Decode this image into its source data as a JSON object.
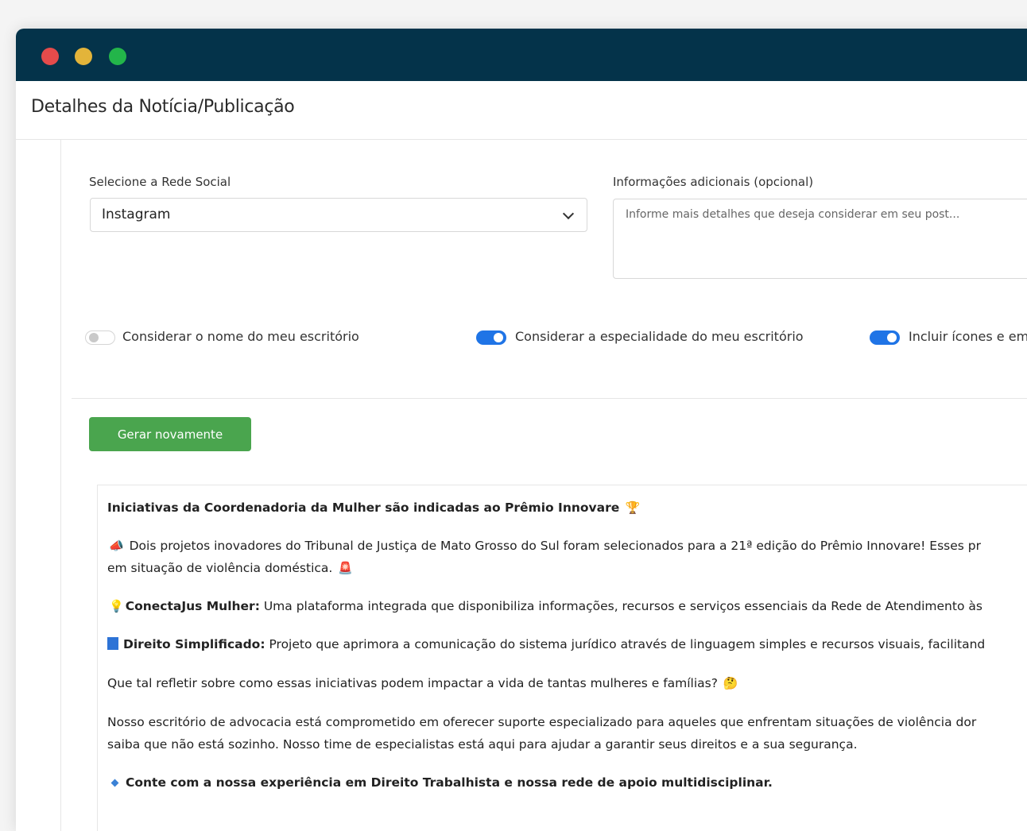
{
  "window": {
    "title": "Detalhes da Notícia/Publicação"
  },
  "form": {
    "social_label": "Selecione a Rede Social",
    "social_value": "Instagram",
    "info_label": "Informações adicionais (opcional)",
    "info_placeholder": "Informe mais detalhes que deseja considerar em seu post..."
  },
  "toggles": [
    {
      "label": "Considerar o nome do meu escritório",
      "on": false
    },
    {
      "label": "Considerar a especialidade do meu escritório",
      "on": true
    },
    {
      "label": "Incluir ícones e em",
      "on": true
    }
  ],
  "actions": {
    "regenerate_label": "Gerar novamente"
  },
  "result": {
    "headline": "Iniciativas da Coordenadoria da Mulher são indicadas ao Prêmio Innovare",
    "p1_line1": "Dois projetos inovadores do Tribunal de Justiça de Mato Grosso do Sul foram selecionados para a 21ª edição do Prêmio Innovare! Esses pr",
    "p1_line2": "em situação de violência doméstica.",
    "p2_bold": "ConectaJus Mulher:",
    "p2_text": " Uma plataforma integrada que disponibiliza informações, recursos e serviços essenciais da Rede de Atendimento às",
    "p3_bold": "Direito Simplificado:",
    "p3_text": " Projeto que aprimora a comunicação do sistema jurídico através de linguagem simples e recursos visuais, facilitand",
    "p4": "Que tal refletir sobre como essas iniciativas podem impactar a vida de tantas mulheres e famílias?",
    "p5_line1": "Nosso escritório de advocacia está comprometido em oferecer suporte especializado para aqueles que enfrentam situações de violência dor",
    "p5_line2": "saiba que não está sozinho. Nosso time de especialistas está aqui para ajudar a garantir seus direitos e a sua segurança.",
    "p6": "Conte com a nossa experiência em Direito Trabalhista e nossa rede de apoio multidisciplinar."
  },
  "icons": [
    "trophy-icon",
    "megaphone-icon",
    "siren-icon",
    "lightbulb-icon",
    "blue-book-icon",
    "thinking-face-icon",
    "blue-diamond-icon"
  ],
  "colors": {
    "titlebar": "#04334a",
    "button": "#4aa54e",
    "toggle_on": "#1f74e6"
  }
}
